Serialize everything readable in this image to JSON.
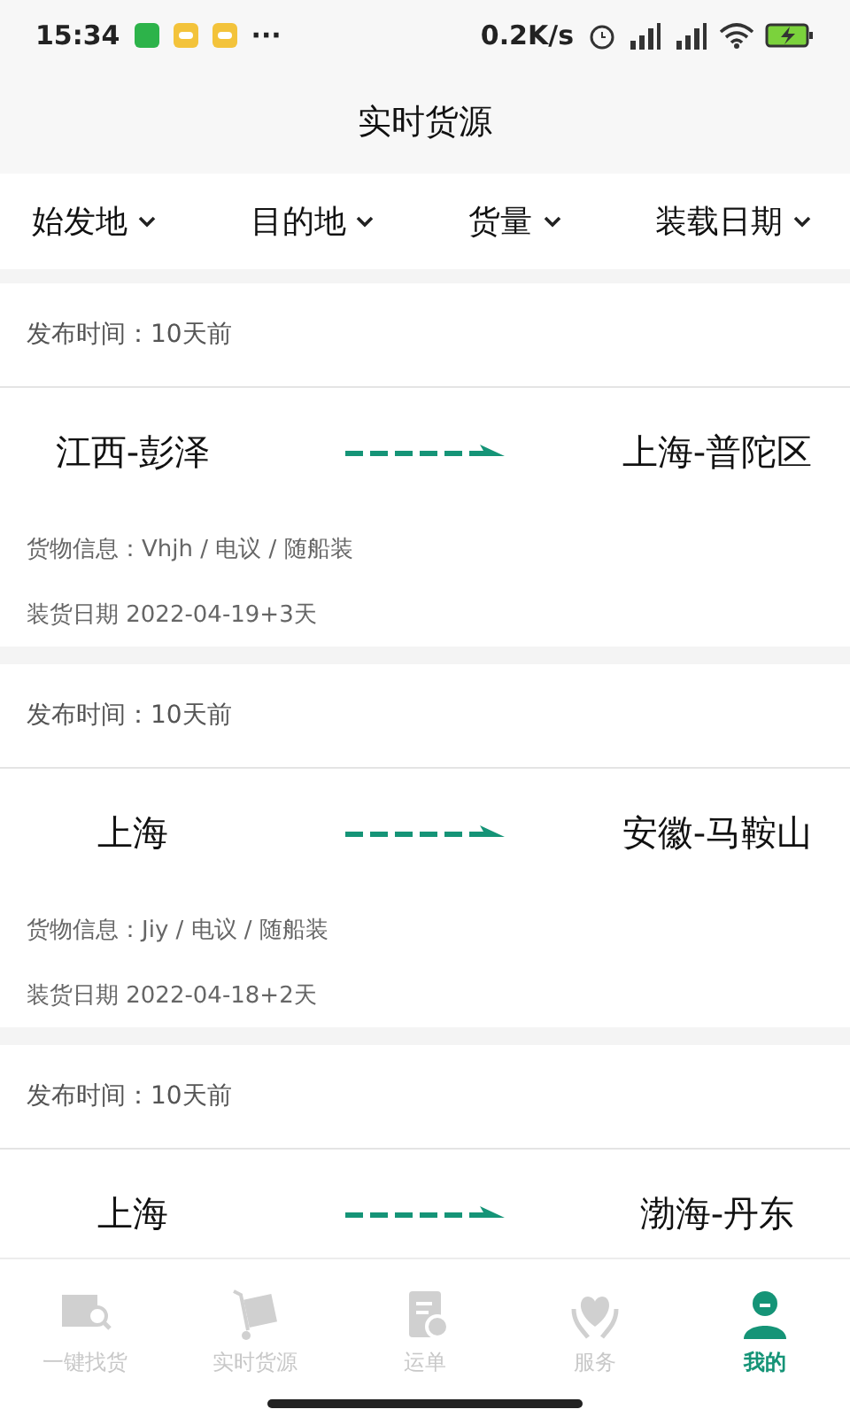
{
  "status_bar": {
    "time": "15:34",
    "more": "···",
    "speed": "0.2K/s"
  },
  "title": "实时货源",
  "filters": [
    {
      "label": "始发地"
    },
    {
      "label": "目的地"
    },
    {
      "label": "货量"
    },
    {
      "label": "装载日期"
    }
  ],
  "cards": [
    {
      "published": "发布时间：10天前",
      "from": "江西-彭泽",
      "to": "上海-普陀区",
      "cargo": "货物信息：Vhjh / 电议 / 随船装",
      "load_date": "装货日期 2022-04-19+3天"
    },
    {
      "published": "发布时间：10天前",
      "from": "上海",
      "to": "安徽-马鞍山",
      "cargo": "货物信息：Jiy / 电议 / 随船装",
      "load_date": "装货日期 2022-04-18+2天"
    },
    {
      "published": "发布时间：10天前",
      "from": "上海",
      "to": "渤海-丹东"
    }
  ],
  "nav": [
    {
      "label": "一键找货",
      "selected": false
    },
    {
      "label": "实时货源",
      "selected": false
    },
    {
      "label": "运单",
      "selected": false
    },
    {
      "label": "服务",
      "selected": false
    },
    {
      "label": "我的",
      "selected": true
    }
  ]
}
